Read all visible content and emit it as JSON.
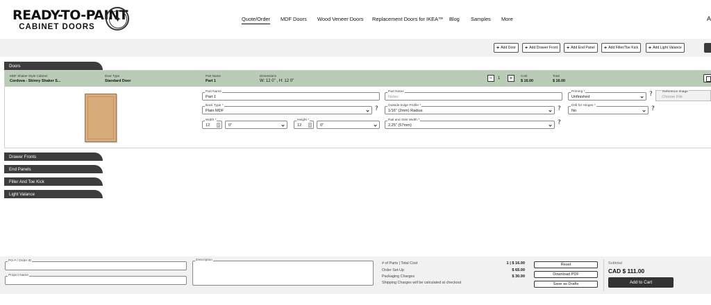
{
  "header": {
    "logo_line1": "READY-TO-PAINT",
    "logo_line2": "CABINET DOORS",
    "nav": [
      "Quote/Order",
      "MDF Doors",
      "Wood Veneer Doors",
      "Replacement Doors for IKEA™",
      "Blog",
      "Samples",
      "More"
    ],
    "nav_edge": "A"
  },
  "toolbar": {
    "buttons": [
      "Add Door",
      "Add Drawer Front",
      "Add End Panel",
      "Add Filler/Toe Kick",
      "Add Light Valance"
    ]
  },
  "sections": {
    "doors": "Doors",
    "drawer_fronts": "Drawer Fronts",
    "end_panels": "End Panels",
    "filler": "Filler And Toe Kick",
    "light_valance": "Light Valance"
  },
  "door_item": {
    "style_label": "MDF Shaker Style Cabinet",
    "style_value": "Cordova - Skinny Shaker S...",
    "type_label": "Door Type",
    "type_value": "Standard Door",
    "part_label": "Part Name",
    "part_value": "Part 1",
    "dim_label": "Dimensions",
    "dim_value": "W: 12 0\"  ,  H: 12 0\"",
    "qty_minus": "−",
    "qty_plus": "+",
    "quantity": "1",
    "cost_label": "Cost",
    "cost_value": "$ 16.00",
    "total_label": "Total",
    "total_value": "$ 16.00"
  },
  "form": {
    "part_name": {
      "label": "Part Name",
      "value": "Part 1"
    },
    "part_notes": {
      "label": "Part Notes",
      "placeholder": "Notes"
    },
    "priming": {
      "label": "Priming *",
      "value": "Unfinished"
    },
    "reference_image": {
      "label": "Reference Image",
      "placeholder": "Choose File"
    },
    "back_type": {
      "label": "Back Type *",
      "value": "Plain MDF"
    },
    "edge_profile": {
      "label": "Outside Edge Profile *",
      "value": "1/16\" (2mm) Radius"
    },
    "drill_hinges": {
      "label": "Drill for Hinges *",
      "value": "No"
    },
    "width": {
      "label": "Width *",
      "value": "12",
      "fraction": "0\""
    },
    "height": {
      "label": "Height *",
      "value": "12",
      "fraction": "0\""
    },
    "rail_stile": {
      "label": "Rail and Stile Width *",
      "value": "2.25\" (57mm)"
    },
    "help": "?"
  },
  "footer": {
    "po_label": "PO # / Order ID",
    "project_label": "Project Name",
    "description_label": "Description",
    "parts_label": "# of Parts | Total Cost",
    "parts_value": "1 | $ 16.00",
    "setup_label": "Order Set-Up",
    "setup_value": "$ 65.00",
    "packaging_label": "Packaging Charges",
    "packaging_value": "$ 30.00",
    "shipping_note": "Shipping Charges will be calculated at checkout",
    "reset": "Reset",
    "download_pdf": "Download PDF",
    "save_drafts": "Save as Drafts",
    "subtotal_label": "Subtotal",
    "subtotal_value": "CAD $ 111.00",
    "add_to_cart": "Add to Cart"
  }
}
